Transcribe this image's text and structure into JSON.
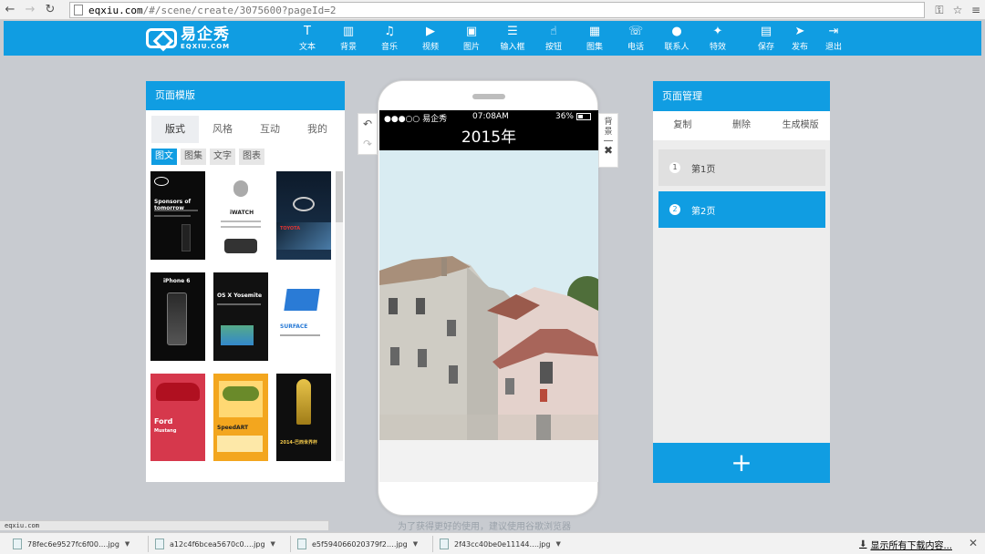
{
  "browser": {
    "url_host": "eqxiu.com",
    "url_path": "/#/scene/create/3075600?pageId=2"
  },
  "app": {
    "logo_cn": "易企秀",
    "logo_en": "EQXIU.COM",
    "tools": [
      {
        "label": "文本",
        "icon": "text-icon"
      },
      {
        "label": "背景",
        "icon": "background-icon"
      },
      {
        "label": "音乐",
        "icon": "music-icon"
      },
      {
        "label": "视频",
        "icon": "video-icon"
      },
      {
        "label": "图片",
        "icon": "image-icon"
      },
      {
        "label": "输入框",
        "icon": "input-box-icon"
      },
      {
        "label": "按钮",
        "icon": "button-icon"
      },
      {
        "label": "图集",
        "icon": "gallery-icon"
      },
      {
        "label": "电话",
        "icon": "phone-icon"
      },
      {
        "label": "联系人",
        "icon": "contact-icon"
      },
      {
        "label": "特效",
        "icon": "effects-icon"
      },
      {
        "label": "保存",
        "icon": "save-icon"
      },
      {
        "label": "发布",
        "icon": "publish-icon"
      },
      {
        "label": "退出",
        "icon": "exit-icon"
      }
    ]
  },
  "left_panel": {
    "title": "页面模版",
    "tabs": [
      "版式",
      "风格",
      "互动",
      "我的"
    ],
    "subtabs": [
      "图文",
      "图集",
      "文字",
      "图表"
    ],
    "thumbs": [
      {
        "title": "intel",
        "subtitle": "Sponsors of tomorrow"
      },
      {
        "title": "iWATCH",
        "subtitle": ""
      },
      {
        "title": "TOYOTA",
        "subtitle": ""
      },
      {
        "title": "iPhone 6",
        "subtitle": ""
      },
      {
        "title": "OS X Yosemite",
        "subtitle": ""
      },
      {
        "title": "SURFACE",
        "subtitle": "Welcome to microsoft surface ¥ 4,900"
      },
      {
        "title": "Ford",
        "subtitle": "Mustang"
      },
      {
        "title": "SpeedART",
        "subtitle": ""
      },
      {
        "title": "2014-巴西世界杯",
        "subtitle": ""
      }
    ]
  },
  "phone": {
    "carrier": "●●●○○ 易企秀",
    "time": "07:08AM",
    "battery": "36%",
    "title": "2015年"
  },
  "side_tools": {
    "background_label": "背景"
  },
  "right_panel": {
    "title": "页面管理",
    "actions": [
      "复制",
      "删除",
      "生成模版"
    ],
    "pages": [
      {
        "num": "1",
        "label": "第1页"
      },
      {
        "num": "2",
        "label": "第2页"
      }
    ],
    "add_label": "+"
  },
  "tip": "为了获得更好的使用，建议使用谷歌浏览器",
  "status_url": "eqxiu.com",
  "downloads": [
    "78fec6e9527fc6f00….jpg",
    "a12c4f6bcea5670c0….jpg",
    "e5f594066020379f2….jpg",
    "2f43cc40be0e11144….jpg"
  ],
  "show_all_downloads": "显示所有下载内容..."
}
